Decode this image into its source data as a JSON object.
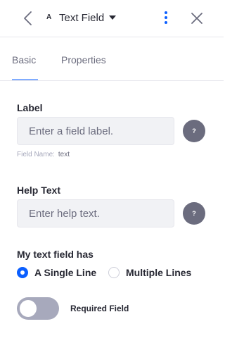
{
  "header": {
    "type_icon": "A",
    "title": "Text Field"
  },
  "tabs": [
    {
      "label": "Basic",
      "active": true
    },
    {
      "label": "Properties",
      "active": false
    }
  ],
  "form": {
    "label_field": {
      "label": "Label",
      "placeholder": "Enter a field label.",
      "help": "?"
    },
    "field_name": {
      "label": "Field Name:",
      "value": "text"
    },
    "help_text_field": {
      "label": "Help Text",
      "placeholder": "Enter help text.",
      "help": "?"
    },
    "text_field_has": {
      "label": "My text field has",
      "options": [
        {
          "label": "A Single Line",
          "selected": true
        },
        {
          "label": "Multiple Lines",
          "selected": false
        }
      ]
    },
    "required": {
      "label": "Required Field",
      "enabled": false
    }
  },
  "colors": {
    "accent": "#0b5fff",
    "tab_underline": "#80acff",
    "toggle_off": "#a7a9bc"
  }
}
